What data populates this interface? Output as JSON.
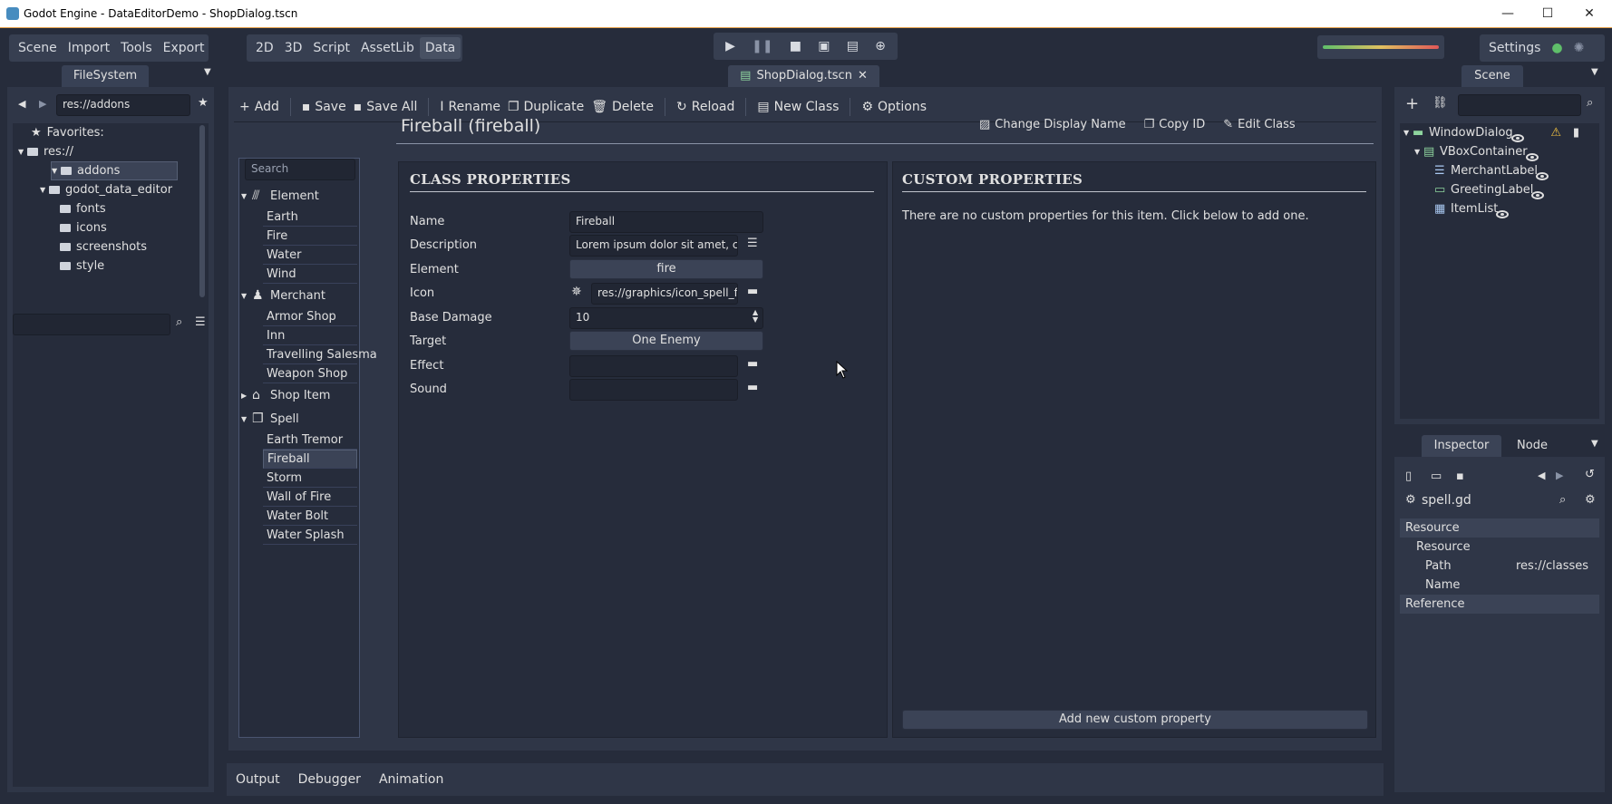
{
  "window": {
    "title": "Godot Engine - DataEditorDemo - ShopDialog.tscn",
    "min": "—",
    "max": "☐",
    "close": "✕"
  },
  "menus": {
    "left": [
      "Scene",
      "Import",
      "Tools",
      "Export"
    ],
    "workspaces": [
      "2D",
      "3D",
      "Script",
      "AssetLib",
      "Data"
    ],
    "active_workspace": "Data",
    "settings": "Settings"
  },
  "filesystem": {
    "tab": "FileSystem",
    "path": "res://addons",
    "favorites": "Favorites:",
    "items": [
      {
        "label": "res://",
        "depth": 0,
        "arrow": "open"
      },
      {
        "label": "addons",
        "depth": 1,
        "arrow": "open",
        "selected": true
      },
      {
        "label": "godot_data_editor",
        "depth": 2,
        "arrow": "open"
      },
      {
        "label": "fonts",
        "depth": 3,
        "arrow": ""
      },
      {
        "label": "icons",
        "depth": 3,
        "arrow": ""
      },
      {
        "label": "screenshots",
        "depth": 3,
        "arrow": ""
      },
      {
        "label": "style",
        "depth": 3,
        "arrow": ""
      }
    ]
  },
  "doc_tab": "ShopDialog.tscn",
  "toolbar": {
    "add": "Add",
    "save": "Save",
    "save_all": "Save All",
    "rename": "Rename",
    "duplicate": "Duplicate",
    "delete": "Delete",
    "reload": "Reload",
    "new_class": "New Class",
    "options": "Options"
  },
  "item_title": "Fireball (fireball)",
  "title_actions": {
    "change_name": "Change Display Name",
    "copy_id": "Copy ID",
    "edit_class": "Edit Class"
  },
  "tree": {
    "search_placeholder": "Search",
    "groups": [
      {
        "label": "Element",
        "items": [
          "Earth",
          "Fire",
          "Water",
          "Wind"
        ],
        "expanded": true
      },
      {
        "label": "Merchant",
        "items": [
          "Armor Shop",
          "Inn",
          "Travelling Salesma",
          "Weapon Shop"
        ],
        "expanded": true
      },
      {
        "label": "Shop Item",
        "items": [],
        "expanded": false
      },
      {
        "label": "Spell",
        "items": [
          "Earth Tremor",
          "Fireball",
          "Storm",
          "Wall of Fire",
          "Water Bolt",
          "Water Splash"
        ],
        "expanded": true
      }
    ],
    "selected": "Fireball"
  },
  "class_props": {
    "header": "CLASS PROPERTIES",
    "rows": [
      {
        "label": "Name",
        "value": "Fireball",
        "kind": "text"
      },
      {
        "label": "Description",
        "value": "Lorem ipsum dolor sit amet, con",
        "kind": "multiline"
      },
      {
        "label": "Element",
        "value": "fire",
        "kind": "button"
      },
      {
        "label": "Icon",
        "value": "res://graphics/icon_spell_fir",
        "kind": "file-icon"
      },
      {
        "label": "Base Damage",
        "value": "10",
        "kind": "spin"
      },
      {
        "label": "Target",
        "value": "One Enemy",
        "kind": "button"
      },
      {
        "label": "Effect",
        "value": "",
        "kind": "file"
      },
      {
        "label": "Sound",
        "value": "",
        "kind": "file"
      }
    ]
  },
  "custom_props": {
    "header": "CUSTOM PROPERTIES",
    "empty_text": "There are no custom properties for this item. Click below to add one.",
    "add_button": "Add new custom property"
  },
  "bottom_tabs": [
    "Output",
    "Debugger",
    "Animation"
  ],
  "scene": {
    "tab": "Scene",
    "nodes": [
      {
        "label": "WindowDialog",
        "depth": 0,
        "warn": true
      },
      {
        "label": "VBoxContainer",
        "depth": 1
      },
      {
        "label": "MerchantLabel",
        "depth": 2
      },
      {
        "label": "GreetingLabel",
        "depth": 2
      },
      {
        "label": "ItemList",
        "depth": 2
      }
    ]
  },
  "inspector": {
    "tabs": [
      "Inspector",
      "Node"
    ],
    "file": "spell.gd",
    "sections": [
      {
        "label": "Resource",
        "kind": "section"
      },
      {
        "label": "Resource",
        "kind": "sub"
      },
      {
        "label": "Path",
        "value": "res://classes",
        "kind": "prop"
      },
      {
        "label": "Name",
        "value": "",
        "kind": "prop"
      },
      {
        "label": "Reference",
        "kind": "section"
      }
    ]
  }
}
